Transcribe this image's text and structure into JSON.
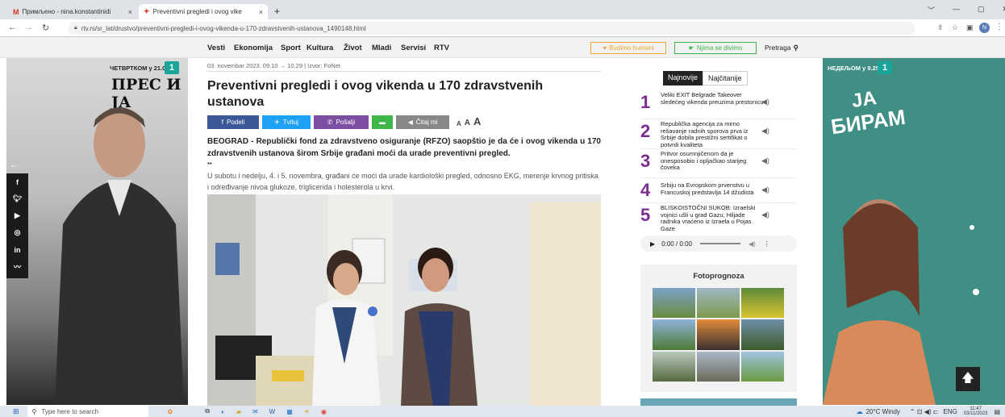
{
  "browser": {
    "tabs": [
      {
        "title": "Примљено - nina.konstantinidi",
        "close": "×"
      },
      {
        "title": "Preventivni pregledi i ovog vike",
        "close": "×"
      }
    ],
    "new_tab": "+",
    "url": "rtv.rs/sr_lat/drustvo/preventivni-pregledi-i-ovog-vikenda-u-170-zdravstvenih-ustanova_1490148.html",
    "window_controls": [
      "﹀",
      "—",
      "▢",
      "✕"
    ],
    "profile_initial": "N"
  },
  "site_nav": {
    "links": [
      "Vesti",
      "Ekonomija",
      "Sport",
      "Kultura",
      "Život",
      "Mladi",
      "Servisi",
      "RTV"
    ],
    "budimo_humani": "Budimo humani",
    "njima_se_divimo": "Njima se divimo",
    "search_label": "Pretraga"
  },
  "ad_left": {
    "time_label": "ЧЕТВРТКОМ у 21.00",
    "channel": "1",
    "show_title": "ПРЕС И ЈА"
  },
  "ad_right": {
    "time_label": "НЕДЕЉОМ у 9.25",
    "channel": "1",
    "show_title_line1": "ЈА",
    "show_title_line2": "БИРАМ"
  },
  "article": {
    "meta": "03. novembar 2023. 09.10 → 10.29 | Izvor: FoNet",
    "title": "Preventivni pregledi i ovog vikenda u 170 zdravstvenih ustanova",
    "share_buttons": {
      "podeli": "Podeli",
      "tvituj": "Tvituj",
      "posalji": "Pošalji",
      "citaj": "Čitaj mi",
      "font_sizes": [
        "A",
        "A",
        "A"
      ]
    },
    "lead": "BEOGRAD - Republički fond za zdravstveno osiguranje (RFZO) saopštio je da će i ovog vikenda u 170 zdravstvenih ustanova širom Srbije građani moći da urade preventivni pregled.",
    "body": "U subotu i nedelju, 4. i 5. novembra, građani će moći da urade kardiološki pregled, odnosno EKG, merenje krvnog pritiska i određivanje nivoa glukoze, triglicerida i holesterola u krvi."
  },
  "sidebar": {
    "tabs": [
      {
        "label": "Najnovije",
        "active": true
      },
      {
        "label": "Najčitanije",
        "active": false
      }
    ],
    "news": [
      {
        "num": "1",
        "text": "Veliki EXIT Belgrade Takeover sledećeg vikenda preuzima prestonicu"
      },
      {
        "num": "2",
        "text": "Republička agencija za mirno rešavanje radnih sporova prva iz Srbije dobila prestižni sertifikat o potvrdi kvaliteta"
      },
      {
        "num": "3",
        "text": "Pritvor osumnjičenom da je onesposobio i opljačkao starijeg čoveka"
      },
      {
        "num": "4",
        "text": "Srbiju na Evropskom prvenstvu u Francuskoj predstavlja 14 džudista"
      },
      {
        "num": "5",
        "text": "BLISKOISTOČNI SUKOB: Izraelski vojnici ušli u grad Gazu; Hiljade radnika vraćeno iz Izraela u Pojas Gaze"
      }
    ],
    "audio_time": "0:00 / 0:00",
    "fotoprognoza_title": "Fotoprognoza"
  },
  "taskbar": {
    "search_placeholder": "Type here to search",
    "weather": "20°C Windy",
    "lang": "ENG",
    "time": "11:47",
    "date": "03/11/2023"
  },
  "colors": {
    "facebook": "#3b5998",
    "twitter": "#1da1f2",
    "viber": "#7d4fa2",
    "sms": "#3fb54a",
    "citaj": "#888888",
    "rank_number": "#7a2d8f",
    "ad_right_bg": "#3f8f84"
  }
}
